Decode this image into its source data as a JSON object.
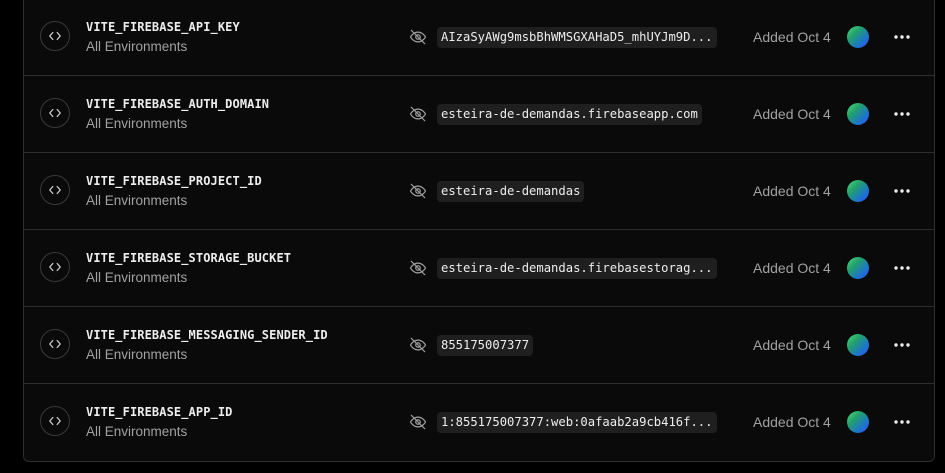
{
  "env_vars": [
    {
      "name": "VITE_FIREBASE_API_KEY",
      "environments": "All Environments",
      "value": "AIzaSyAWg9msbBhWMSGXAHaD5_mhUYJm9D...",
      "added": "Added Oct 4"
    },
    {
      "name": "VITE_FIREBASE_AUTH_DOMAIN",
      "environments": "All Environments",
      "value": "esteira-de-demandas.firebaseapp.com",
      "added": "Added Oct 4"
    },
    {
      "name": "VITE_FIREBASE_PROJECT_ID",
      "environments": "All Environments",
      "value": "esteira-de-demandas",
      "added": "Added Oct 4"
    },
    {
      "name": "VITE_FIREBASE_STORAGE_BUCKET",
      "environments": "All Environments",
      "value": "esteira-de-demandas.firebasestorag...",
      "added": "Added Oct 4"
    },
    {
      "name": "VITE_FIREBASE_MESSAGING_SENDER_ID",
      "environments": "All Environments",
      "value": "855175007377",
      "added": "Added Oct 4"
    },
    {
      "name": "VITE_FIREBASE_APP_ID",
      "environments": "All Environments",
      "value": "1:855175007377:web:0afaab2a9cb416f...",
      "added": "Added Oct 4"
    }
  ],
  "icons": {
    "variable": "code-brackets-icon",
    "visibility": "eye-off-icon",
    "menu": "more-horizontal-icon"
  },
  "colors": {
    "background": "#0a0a0a",
    "border": "#2e2e2e",
    "text_primary": "#ededed",
    "text_secondary": "#a1a1a1",
    "chip_background": "#1f1f1f"
  }
}
